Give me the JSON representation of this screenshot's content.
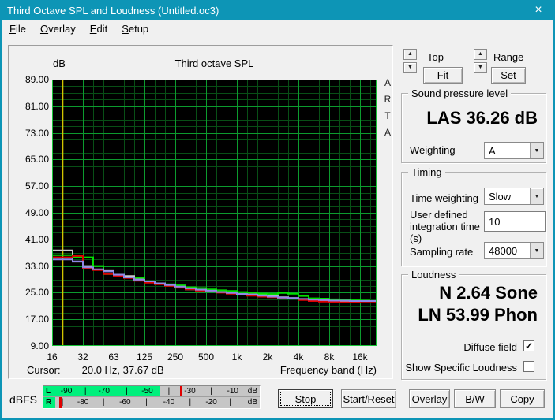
{
  "window": {
    "title": "Third Octave SPL and Loudness (Untitled.oc3)"
  },
  "glyphs": {
    "close": "×",
    "up": "▲",
    "down": "▼",
    "check": "✓"
  },
  "menu": {
    "items": [
      "File",
      "Overlay",
      "Edit",
      "Setup"
    ]
  },
  "zoom_controls": {
    "top": "Top",
    "fit": "Fit",
    "range": "Range",
    "set": "Set"
  },
  "spl": {
    "title": "Sound pressure level",
    "value": "LAS 36.26 dB",
    "weighting_label": "Weighting",
    "weighting": "A"
  },
  "timing": {
    "title": "Timing",
    "time_weighting_label": "Time weighting",
    "time_weighting": "Slow",
    "integration_label": "User defined integration time (s)",
    "integration_time": "10",
    "sampling_label": "Sampling rate",
    "sampling_rate": "48000"
  },
  "loudness": {
    "title": "Loudness",
    "n_value": "N 2.64 Sone",
    "ln_value": "LN 53.99 Phon",
    "diffuse_label": "Diffuse field",
    "diffuse_checked": true,
    "specific_label": "Show Specific Loudness",
    "specific_checked": false
  },
  "meter": {
    "label": "dBFS",
    "unit": "dB",
    "colors": {
      "fill": "#00f07c",
      "peak": "#e00000"
    },
    "rows": [
      {
        "channel": "L",
        "fill_pct": 54,
        "peak_pct": 63,
        "labels": [
          {
            "text": "-90",
            "pct": 10.6
          },
          {
            "text": "-70",
            "pct": 28
          },
          {
            "text": "-50",
            "pct": 48
          },
          {
            "text": "-30",
            "pct": 67.7
          },
          {
            "text": "-10",
            "pct": 87.5
          }
        ],
        "ticks": [
          19.4,
          38.5,
          58,
          77.6
        ]
      },
      {
        "channel": "R",
        "fill_pct": 5.5,
        "peak_pct": 7.3,
        "labels": [
          {
            "text": "-80",
            "pct": 18.3
          },
          {
            "text": "-60",
            "pct": 37.7
          },
          {
            "text": "-40",
            "pct": 58
          },
          {
            "text": "-20",
            "pct": 77.6
          }
        ],
        "ticks": [
          8.8,
          27.8,
          47.6,
          67.8,
          86.4
        ]
      }
    ]
  },
  "buttons": [
    {
      "label": "Stop",
      "default": true
    },
    {
      "label": "Start/Reset"
    },
    {
      "label": "Overlay"
    },
    {
      "label": "B/W"
    },
    {
      "label": "Copy"
    }
  ],
  "chart_data": {
    "type": "line",
    "title": "Third octave SPL",
    "ylabel": "dB",
    "xlabel": "Frequency band (Hz)",
    "watermark": "ARTA",
    "ylim": [
      9,
      89
    ],
    "ymajor_step": 8,
    "yminor_step": 2,
    "yticks": [
      "89.00",
      "81.00",
      "73.00",
      "65.00",
      "57.00",
      "49.00",
      "41.00",
      "33.00",
      "25.00",
      "17.00",
      "9.00"
    ],
    "xticks": [
      "16",
      "32",
      "63",
      "125",
      "250",
      "500",
      "1k",
      "2k",
      "4k",
      "8k",
      "16k"
    ],
    "bands_per_octave": 3,
    "frequencies": [
      16,
      20,
      25,
      31.5,
      40,
      50,
      63,
      80,
      100,
      125,
      160,
      200,
      250,
      315,
      400,
      500,
      630,
      800,
      1000,
      1250,
      1600,
      2000,
      2500,
      3150,
      4000,
      5000,
      6300,
      8000,
      10000,
      12500,
      16000
    ],
    "cursor": {
      "label": "Cursor:",
      "text": "20.0 Hz, 37.67 dB",
      "freq_hz": 20.0,
      "value_db": 37.67,
      "color": "#d2c400"
    },
    "grid": {
      "bg": "#000000",
      "minor": "#084f16",
      "major": "#0c9b2e",
      "border": "#17c437"
    },
    "series": [
      {
        "name": "overlay-gray",
        "color": "#c9c9c9",
        "extend_to_edge": false,
        "values": [
          37.7,
          37.7,
          34.3,
          33.0,
          31.9,
          31.5,
          30.4,
          30.0,
          29.0,
          28.4,
          27.8,
          27.3,
          26.6,
          26.0,
          25.8,
          25.5,
          25.2,
          24.8,
          24.6,
          24.9,
          24.4,
          23.9,
          23.6,
          23.4,
          23.0,
          22.8,
          22.7,
          22.6,
          22.5,
          22.5,
          22.4
        ]
      },
      {
        "name": "overlay-green",
        "color": "#00df00",
        "extend_to_edge": false,
        "values": [
          36.3,
          36.3,
          35.6,
          35.6,
          33.0,
          30.6,
          30.2,
          29.6,
          29.5,
          28.1,
          27.6,
          27.5,
          27.2,
          26.6,
          26.4,
          26.0,
          25.7,
          25.5,
          25.2,
          25.0,
          24.7,
          24.6,
          24.9,
          24.7,
          24.0,
          23.3,
          23.2,
          23.0,
          22.8,
          22.7,
          22.6
        ]
      },
      {
        "name": "overlay-red",
        "color": "#dd0000",
        "extend_to_edge": true,
        "values": [
          35.6,
          35.6,
          36.0,
          32.2,
          31.8,
          30.6,
          30.0,
          29.4,
          28.6,
          28.0,
          27.5,
          27.0,
          26.5,
          26.0,
          25.6,
          25.4,
          25.0,
          24.7,
          24.5,
          24.1,
          23.8,
          23.6,
          23.3,
          23.2,
          22.8,
          22.5,
          22.3,
          22.2,
          22.1,
          22.1,
          22.3
        ]
      },
      {
        "name": "current-blue",
        "color": "#8f88e8",
        "extend_to_edge": true,
        "values": [
          35.0,
          35.0,
          34.4,
          32.6,
          32.0,
          31.4,
          30.4,
          29.6,
          28.9,
          28.4,
          27.8,
          27.3,
          26.8,
          26.3,
          25.9,
          25.6,
          25.2,
          24.9,
          24.6,
          24.4,
          24.1,
          23.8,
          23.5,
          23.4,
          23.1,
          22.9,
          22.8,
          22.6,
          22.6,
          22.5,
          22.5
        ]
      }
    ]
  }
}
